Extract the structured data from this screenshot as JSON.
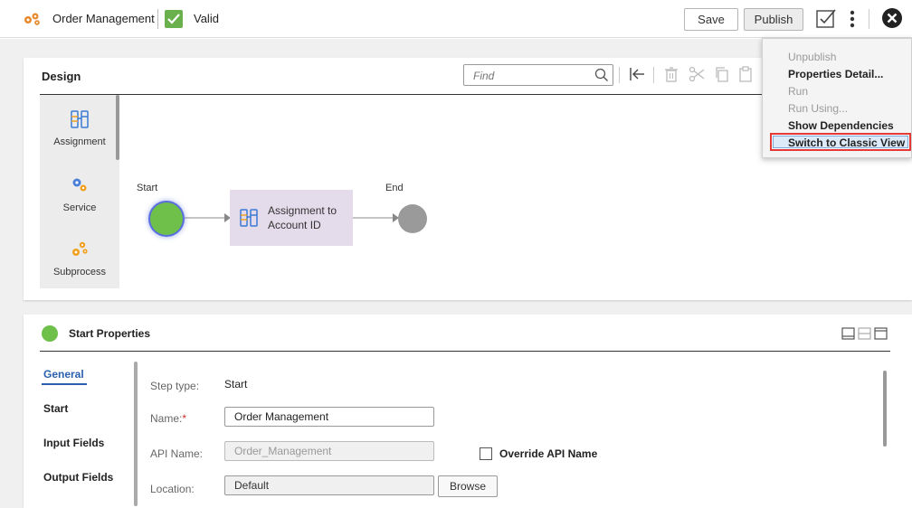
{
  "topbar": {
    "title": "Order Management",
    "status": "Valid",
    "save_label": "Save",
    "publish_label": "Publish"
  },
  "design": {
    "title": "Design",
    "find_placeholder": "Find",
    "palette": [
      {
        "label": "Assignment",
        "icon": "assignment-icon"
      },
      {
        "label": "Service",
        "icon": "service-gears-icon"
      },
      {
        "label": "Subprocess",
        "icon": "subprocess-icon"
      }
    ],
    "flow": {
      "start_label": "Start",
      "end_label": "End",
      "assignment_node": "Assignment to Account ID"
    }
  },
  "menu": {
    "items": [
      {
        "label": "Unpublish",
        "enabled": false
      },
      {
        "label": "Properties Detail...",
        "enabled": true
      },
      {
        "label": "Run",
        "enabled": false
      },
      {
        "label": "Run Using...",
        "enabled": false
      },
      {
        "label": "Show Dependencies",
        "enabled": true
      },
      {
        "label": "Switch to Classic View",
        "enabled": true,
        "highlighted": true
      }
    ]
  },
  "properties": {
    "title": "Start Properties",
    "nav": [
      "General",
      "Start",
      "Input Fields",
      "Output Fields"
    ],
    "active_nav": "General",
    "step_type_label": "Step type:",
    "step_type_value": "Start",
    "name_label": "Name:",
    "name_required_mark": "*",
    "name_value": "Order Management",
    "api_name_label": "API Name:",
    "api_name_value": "Order_Management",
    "override_label": "Override API Name",
    "location_label": "Location:",
    "location_value": "Default",
    "browse_label": "Browse"
  },
  "colors": {
    "valid_green": "#6ab04c",
    "start_green": "#6ec04a",
    "end_gray": "#9a9a9a",
    "assignment_bg": "#e4dbeb",
    "highlight_border": "#e53935",
    "active_nav": "#2a5fb0"
  }
}
